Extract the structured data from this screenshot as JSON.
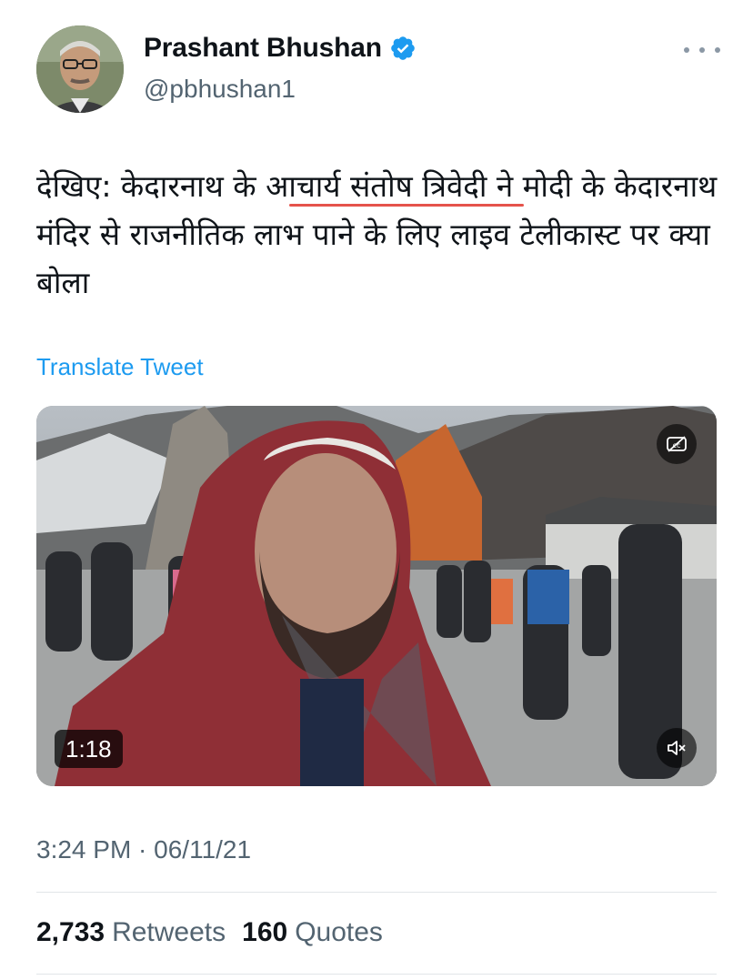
{
  "author": {
    "display_name": "Prashant Bhushan",
    "handle": "@pbhushan1",
    "verified": true
  },
  "tweet": {
    "text": "देखिए: केदारनाथ के आचार्य संतोष त्रिवेदी ने मोदी के केदारनाथ मंदिर से राजनीतिक लाभ पाने के लिए लाइव टेलीकास्ट पर क्या बोला",
    "translate_label": "Translate Tweet",
    "timestamp": "3:24 PM · 06/11/21"
  },
  "media": {
    "duration": "1:18",
    "controls": [
      "captions-off-icon",
      "mute-icon"
    ]
  },
  "stats": {
    "retweets_count": "2,733",
    "retweets_label": "Retweets",
    "quotes_count": "160",
    "quotes_label": "Quotes"
  },
  "colors": {
    "link_blue": "#1d9bf0",
    "verified_blue": "#1d9bf0",
    "underline_red": "#e5534b",
    "secondary_text": "#536471"
  }
}
